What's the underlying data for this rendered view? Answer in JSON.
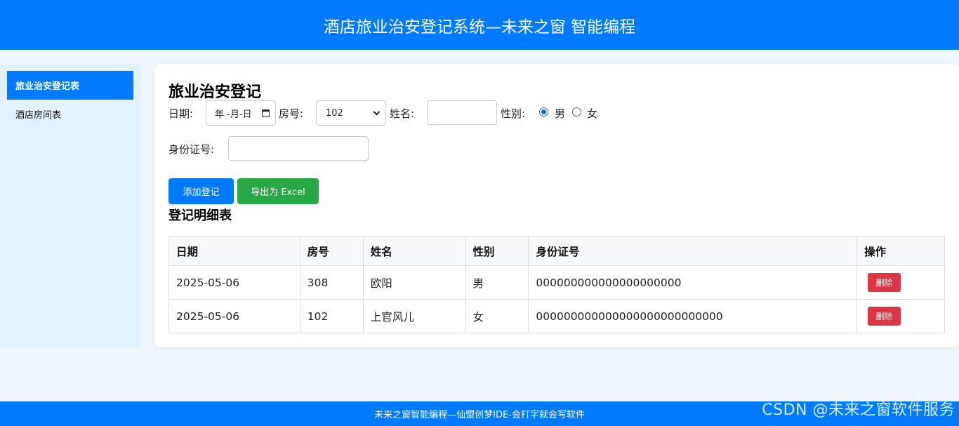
{
  "header": {
    "title": "酒店旅业治安登记系统—未来之窗 智能编程"
  },
  "sidebar": {
    "items": [
      {
        "label": "旅业治安登记表",
        "active": true
      },
      {
        "label": "酒店房间表",
        "active": false
      }
    ]
  },
  "form": {
    "title": "旅业治安登记",
    "date_label": "日期:",
    "date_value": "年 -月-日",
    "room_label": "房号:",
    "room_value": "102",
    "name_label": "姓名:",
    "name_value": "",
    "gender_label": "性别:",
    "gender_options": [
      "男",
      "女"
    ],
    "gender_selected": "男",
    "id_label": "身份证号:",
    "id_value": "",
    "add_button": "添加登记",
    "export_button": "导出为 Excel"
  },
  "table": {
    "title": "登记明细表",
    "headers": [
      "日期",
      "房号",
      "姓名",
      "性别",
      "身份证号",
      "操作"
    ],
    "rows": [
      {
        "date": "2025-05-06",
        "room": "308",
        "name": "欧阳",
        "gender": "男",
        "id": "000000000000000000000",
        "action": "删除"
      },
      {
        "date": "2025-05-06",
        "room": "102",
        "name": "上官风儿",
        "gender": "女",
        "id": "000000000000000000000000000",
        "action": "删除"
      }
    ]
  },
  "footer": {
    "text": "未来之窗智能编程—仙盟创梦IDE-会打字就会写软件"
  },
  "watermark": "CSDN @未来之窗软件服务",
  "colors": {
    "primary": "#007bff",
    "success": "#28a745",
    "danger": "#dc3545",
    "sidebar_bg": "#e1f1fe"
  }
}
